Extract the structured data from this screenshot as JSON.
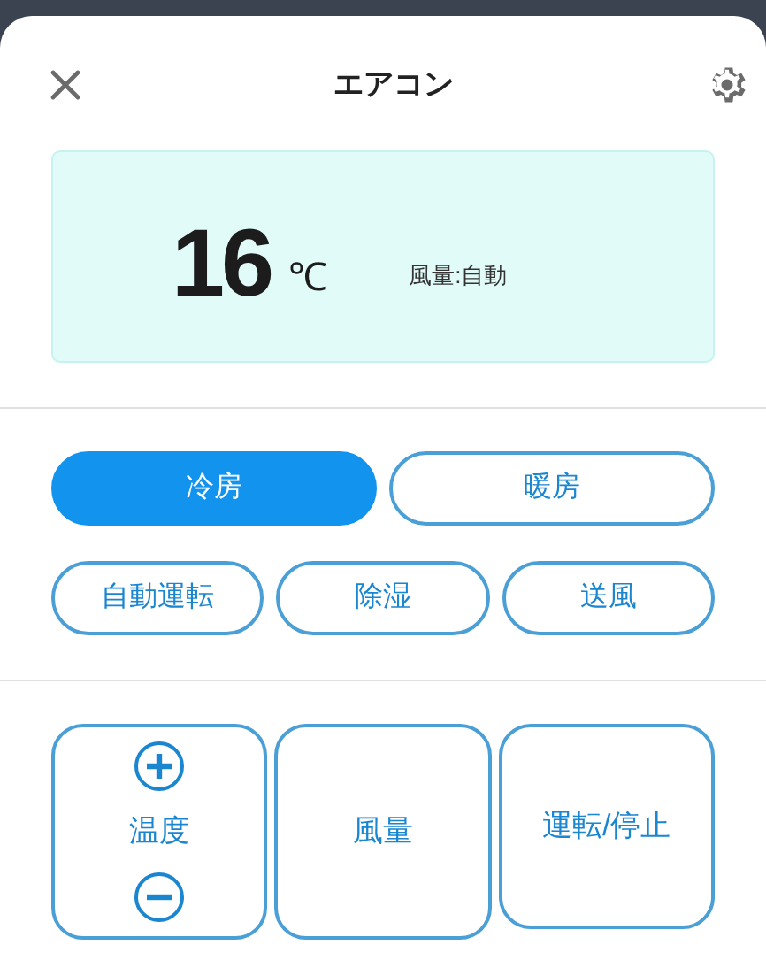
{
  "header": {
    "title": "エアコン"
  },
  "display": {
    "temperature": "16",
    "unit": "℃",
    "fan": "風量:自動"
  },
  "modes": [
    {
      "label": "冷房",
      "selected": true
    },
    {
      "label": "暖房",
      "selected": false
    },
    {
      "label": "自動運転",
      "selected": false
    },
    {
      "label": "除湿",
      "selected": false
    },
    {
      "label": "送風",
      "selected": false
    }
  ],
  "controls": [
    {
      "kind": "stepper",
      "label": "温度"
    },
    {
      "kind": "button",
      "label": "風量"
    },
    {
      "kind": "button",
      "label": "運転/停止"
    }
  ]
}
